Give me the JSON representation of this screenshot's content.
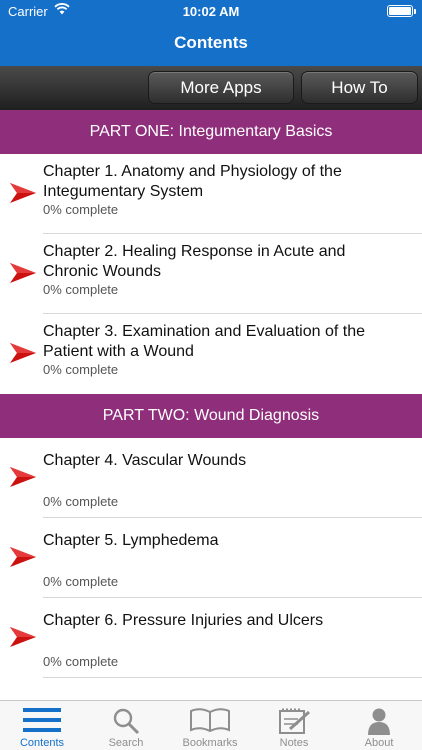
{
  "status": {
    "carrier": "Carrier",
    "time": "10:02 AM"
  },
  "nav": {
    "title": "Contents"
  },
  "toolbar": {
    "more_apps": "More Apps",
    "how_to": "How To"
  },
  "sections": [
    {
      "title": "PART ONE: Integumentary Basics",
      "chapters": [
        {
          "title": "Chapter 1. Anatomy and Physiology of the Integumentary System",
          "progress": "0% complete"
        },
        {
          "title": "Chapter 2. Healing Response in Acute and Chronic Wounds",
          "progress": "0% complete"
        },
        {
          "title": "Chapter 3. Examination and Evaluation of the Patient with a Wound",
          "progress": "0% complete"
        }
      ]
    },
    {
      "title": "PART TWO: Wound Diagnosis",
      "chapters": [
        {
          "title": "Chapter 4. Vascular Wounds",
          "progress": "0% complete"
        },
        {
          "title": "Chapter 5. Lymphedema",
          "progress": "0% complete"
        },
        {
          "title": "Chapter 6. Pressure Injuries and Ulcers",
          "progress": "0% complete"
        }
      ]
    }
  ],
  "tabs": [
    {
      "label": "Contents",
      "icon": "list-icon",
      "active": true
    },
    {
      "label": "Search",
      "icon": "search-icon",
      "active": false
    },
    {
      "label": "Bookmarks",
      "icon": "book-icon",
      "active": false
    },
    {
      "label": "Notes",
      "icon": "notepad-icon",
      "active": false
    },
    {
      "label": "About",
      "icon": "person-icon",
      "active": false
    }
  ],
  "colors": {
    "nav_blue": "#1570c9",
    "section_purple": "#8f2f7c",
    "arrow_red": "#cc1111"
  }
}
